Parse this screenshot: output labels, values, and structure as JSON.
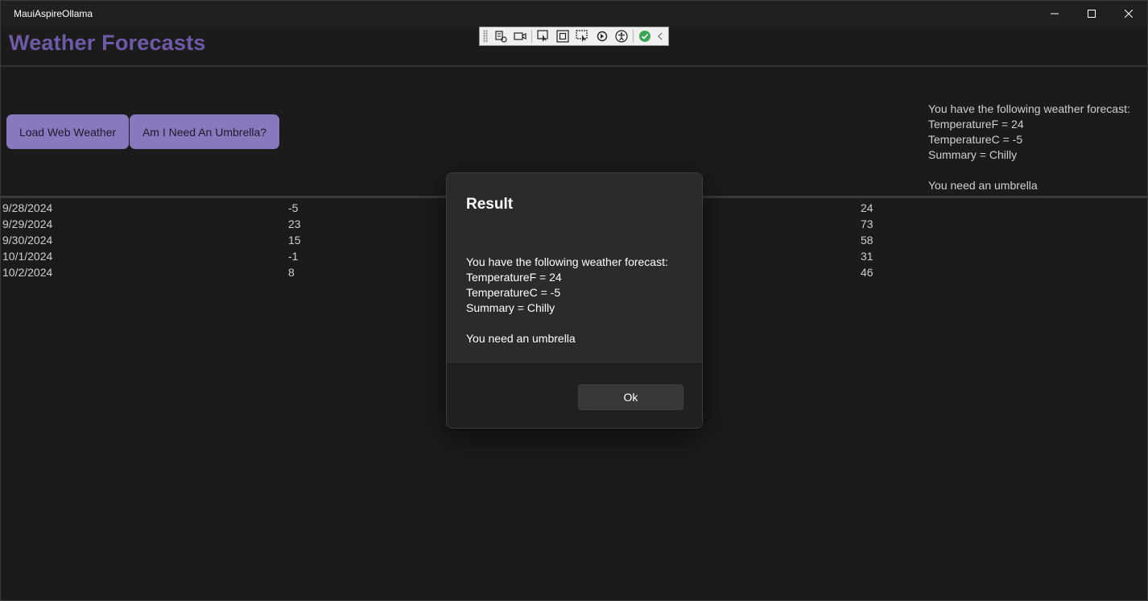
{
  "window": {
    "title": "MauiAspireOllama"
  },
  "header": {
    "title": "Weather Forecasts",
    "title_color": "#6e5aa8"
  },
  "devtools": {
    "tools": [
      "live-visual-tree-icon",
      "record-icon",
      "select-element-icon",
      "display-layout-adorners-icon",
      "track-focused-element-icon",
      "hot-reload-icon",
      "accessibility-checker-icon",
      "checkmark-icon",
      "collapse-chevron-icon"
    ]
  },
  "buttons": {
    "load_web_weather": "Load Web Weather",
    "umbrella": "Am I Need An Umbrella?",
    "accent": "#8a78be"
  },
  "summary": {
    "text": "You have the following weather forecast:\nTemperatureF = 24\nTemperatureC = -5\nSummary = Chilly\n\nYou need an umbrella"
  },
  "forecasts": [
    {
      "date": "9/28/2024",
      "temp_c": "-5",
      "temp_f": "24"
    },
    {
      "date": "9/29/2024",
      "temp_c": "23",
      "temp_f": "73"
    },
    {
      "date": "9/30/2024",
      "temp_c": "15",
      "temp_f": "58"
    },
    {
      "date": "10/1/2024",
      "temp_c": "-1",
      "temp_f": "31"
    },
    {
      "date": "10/2/2024",
      "temp_c": "8",
      "temp_f": "46"
    }
  ],
  "dialog": {
    "title": "Result",
    "body": "You have the following weather forecast:\nTemperatureF = 24\nTemperatureC = -5\nSummary = Chilly\n\nYou need an umbrella",
    "ok_label": "Ok"
  }
}
